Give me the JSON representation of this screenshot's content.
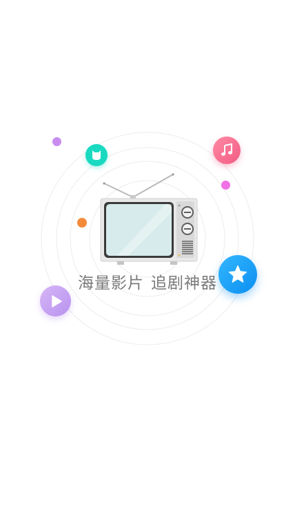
{
  "splash": {
    "slogan_part1": "海量影片",
    "slogan_part2": "追剧神器"
  },
  "icons": {
    "teal_badge": "cat-face-icon",
    "pink_badge": "music-note-icon",
    "blue_badge": "star-icon",
    "purple_badge": "play-icon",
    "center": "television-icon"
  },
  "colors": {
    "background": "#ffffff",
    "slogan_text": "#7a7a7a",
    "teal": "#19d9c1",
    "pink": "#f25b83",
    "blue": "#0c8ff0",
    "lavender": "#b892ef",
    "orange": "#f38a3a",
    "magenta": "#f070e6",
    "purple": "#c98df0"
  }
}
